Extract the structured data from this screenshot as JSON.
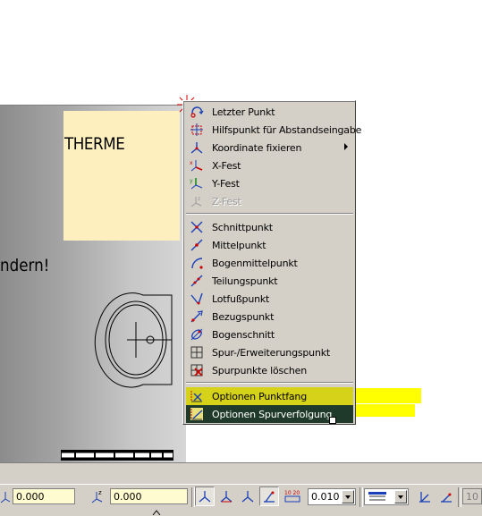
{
  "canvas": {
    "note_text": "THERME",
    "partial_text": "ndern!",
    "note_color": "#fdf0be"
  },
  "context_menu": {
    "items": [
      {
        "label": "Letzter Punkt",
        "icon": "last-point-icon",
        "enabled": true
      },
      {
        "label": "Hilfspunkt für Abstandseingabe",
        "icon": "helper-point-icon",
        "enabled": true
      },
      {
        "label": "Koordinate fixieren",
        "icon": "fix-coordinate-icon",
        "enabled": true,
        "submenu": true
      },
      {
        "label": "X-Fest",
        "icon": "x-fixed-icon",
        "enabled": true
      },
      {
        "label": "Y-Fest",
        "icon": "y-fixed-icon",
        "enabled": true
      },
      {
        "label": "Z-Fest",
        "icon": "z-fixed-icon",
        "enabled": false
      },
      {
        "label": "Schnittpunkt",
        "icon": "intersection-icon",
        "enabled": true
      },
      {
        "label": "Mittelpunkt",
        "icon": "midpoint-icon",
        "enabled": true
      },
      {
        "label": "Bogenmittelpunkt",
        "icon": "arc-center-icon",
        "enabled": true
      },
      {
        "label": "Teilungspunkt",
        "icon": "division-point-icon",
        "enabled": true
      },
      {
        "label": "Lotfußpunkt",
        "icon": "perpendicular-foot-icon",
        "enabled": true
      },
      {
        "label": "Bezugspunkt",
        "icon": "reference-point-icon",
        "enabled": true
      },
      {
        "label": "Bogenschnitt",
        "icon": "arc-intersection-icon",
        "enabled": true
      },
      {
        "label": "Spur-/Erweiterungspunkt",
        "icon": "track-extension-icon",
        "enabled": true
      },
      {
        "label": "Spurpunkte löschen",
        "icon": "delete-track-points-icon",
        "enabled": true
      },
      {
        "label": "Optionen Punktfang",
        "icon": "snap-options-icon",
        "enabled": true,
        "state": "highlighted"
      },
      {
        "label": "Optionen Spurverfolgung",
        "icon": "tracking-options-icon",
        "enabled": true,
        "state": "selected"
      }
    ],
    "highlight_color": "#ffff00",
    "selected_color": "#1f3a2a"
  },
  "toolbar": {
    "coord_value_1": "0.000",
    "coord_value_2": "0.000",
    "pen_size": "0.010",
    "partial_value": "10"
  }
}
